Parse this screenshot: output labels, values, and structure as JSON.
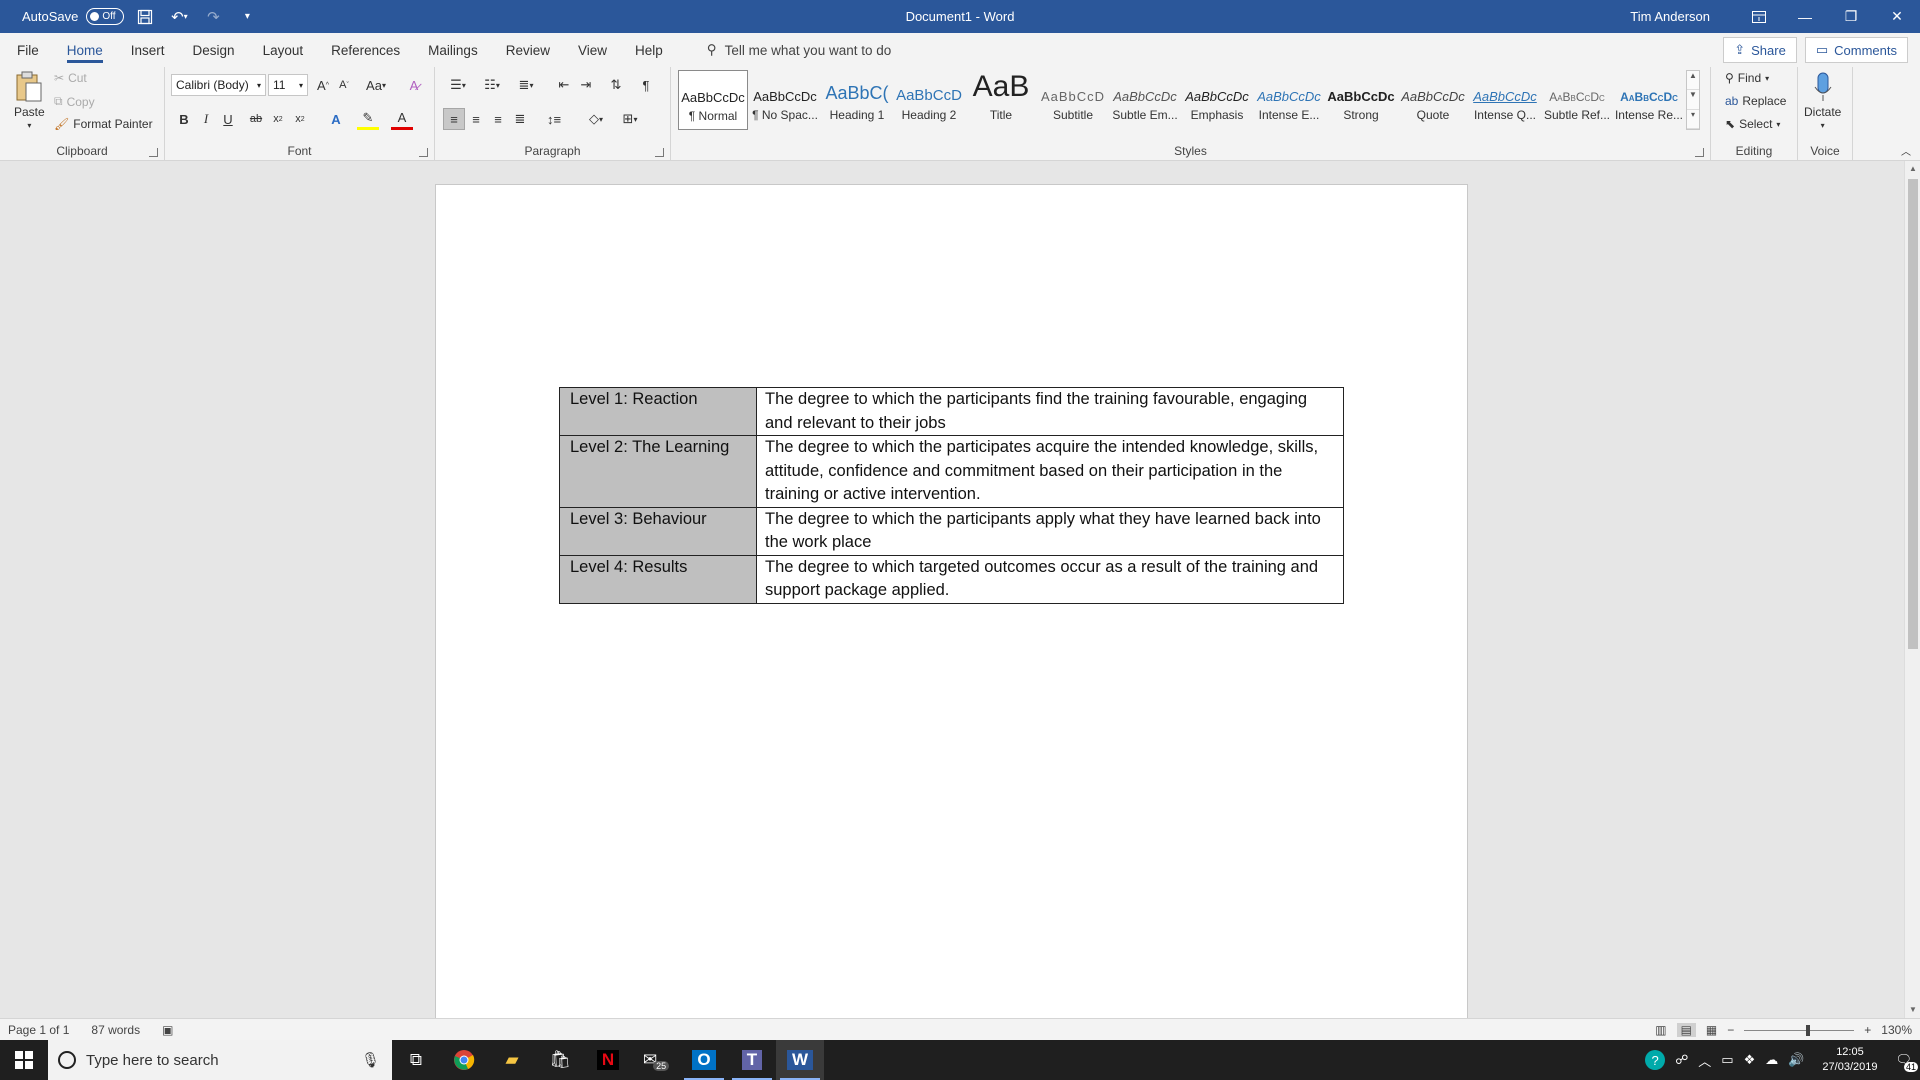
{
  "titlebar": {
    "autosave_label": "AutoSave",
    "autosave_state": "Off",
    "title": "Document1 - Word",
    "user": "Tim Anderson"
  },
  "tabs": [
    "File",
    "Home",
    "Insert",
    "Design",
    "Layout",
    "References",
    "Mailings",
    "Review",
    "View",
    "Help"
  ],
  "active_tab": "Home",
  "tell_me": "Tell me what you want to do",
  "share_label": "Share",
  "comments_label": "Comments",
  "ribbon": {
    "clipboard": {
      "label": "Clipboard",
      "paste": "Paste",
      "cut": "Cut",
      "copy": "Copy",
      "format_painter": "Format Painter"
    },
    "font": {
      "label": "Font",
      "font_name": "Calibri (Body)",
      "font_size": "11"
    },
    "paragraph": {
      "label": "Paragraph"
    },
    "styles": {
      "label": "Styles",
      "items": [
        {
          "preview": "AaBbCcDc",
          "name": "¶ Normal"
        },
        {
          "preview": "AaBbCcDc",
          "name": "¶ No Spac..."
        },
        {
          "preview": "AaBbC(",
          "name": "Heading 1"
        },
        {
          "preview": "AaBbCcD",
          "name": "Heading 2"
        },
        {
          "preview": "AaB",
          "name": "Title"
        },
        {
          "preview": "AaBbCcD",
          "name": "Subtitle"
        },
        {
          "preview": "AaBbCcDc",
          "name": "Subtle Em..."
        },
        {
          "preview": "AaBbCcDc",
          "name": "Emphasis"
        },
        {
          "preview": "AaBbCcDc",
          "name": "Intense E..."
        },
        {
          "preview": "AaBbCcDc",
          "name": "Strong"
        },
        {
          "preview": "AaBbCcDc",
          "name": "Quote"
        },
        {
          "preview": "AaBbCcDc",
          "name": "Intense Q..."
        },
        {
          "preview": "AaBbCcDc",
          "name": "Subtle Ref..."
        },
        {
          "preview": "AaBbCcDc",
          "name": "Intense Re..."
        }
      ]
    },
    "editing": {
      "label": "Editing",
      "find": "Find",
      "replace": "Replace",
      "select": "Select"
    },
    "voice": {
      "label": "Voice",
      "dictate": "Dictate"
    }
  },
  "document": {
    "table": [
      {
        "level": "Level 1: Reaction",
        "description": "The degree to which the participants find the training favourable, engaging and relevant to their jobs"
      },
      {
        "level": "Level 2: The Learning",
        "description": "The degree to which the participates acquire the intended knowledge, skills, attitude, confidence and commitment based on their participation in the training or active intervention."
      },
      {
        "level": "Level 3: Behaviour",
        "description": "The degree to which the participants apply what they have learned back into the work place"
      },
      {
        "level": "Level 4: Results",
        "description": "The degree to which targeted outcomes occur as a result of the training and support package applied."
      }
    ]
  },
  "statusbar": {
    "page": "Page 1 of 1",
    "words": "87 words",
    "zoom": "130%"
  },
  "taskbar": {
    "search_placeholder": "Type here to search",
    "mail_badge": "25",
    "time": "12:05",
    "date": "27/03/2019",
    "notification_count": "41"
  },
  "colors": {
    "word_blue": "#2b579a",
    "table_shade": "#bfbfbf"
  }
}
